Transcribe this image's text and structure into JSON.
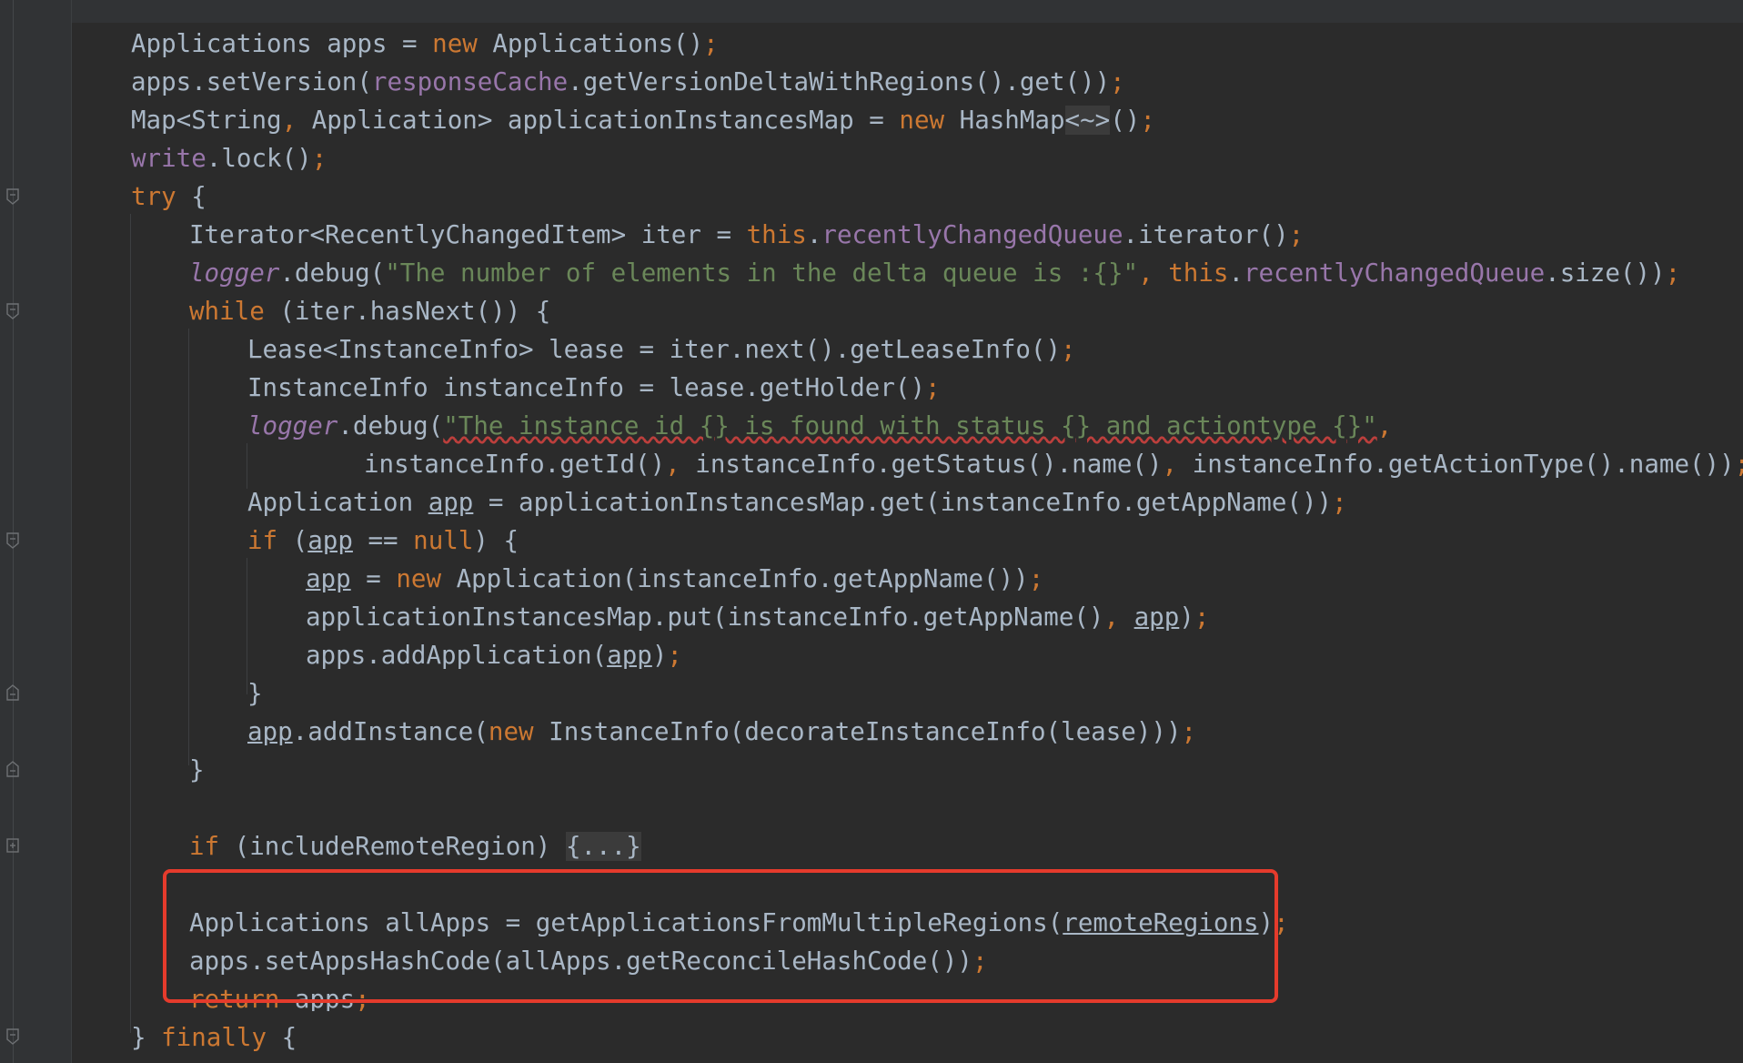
{
  "editor": {
    "lines": [
      {
        "id": "l1",
        "segments": [
          {
            "t": "Applications apps = "
          },
          {
            "t": "new",
            "c": "kw"
          },
          {
            "t": " Applications()"
          },
          {
            "t": ";",
            "c": "kw"
          }
        ]
      },
      {
        "id": "l2",
        "segments": [
          {
            "t": "apps.setVersion("
          },
          {
            "t": "responseCache",
            "c": "fld"
          },
          {
            "t": ".getVersionDeltaWithRegions().get())"
          },
          {
            "t": ";",
            "c": "kw"
          }
        ]
      },
      {
        "id": "l3",
        "segments": [
          {
            "t": "Map<String"
          },
          {
            "t": ",",
            "c": "kw"
          },
          {
            "t": " Application> applicationInstancesMap = "
          },
          {
            "t": "new",
            "c": "kw"
          },
          {
            "t": " HashMap"
          },
          {
            "t": "<~>",
            "c": "sel"
          },
          {
            "t": "()"
          },
          {
            "t": ";",
            "c": "kw"
          }
        ]
      },
      {
        "id": "l4",
        "segments": [
          {
            "t": "write",
            "c": "fld"
          },
          {
            "t": ".lock()"
          },
          {
            "t": ";",
            "c": "kw"
          }
        ]
      },
      {
        "id": "l5",
        "segments": [
          {
            "t": "try",
            "c": "kw"
          },
          {
            "t": " {"
          }
        ]
      },
      {
        "id": "l6",
        "segments": [
          {
            "t": "Iterator<RecentlyChangedItem> iter = "
          },
          {
            "t": "this",
            "c": "kw"
          },
          {
            "t": "."
          },
          {
            "t": "recentlyChangedQueue",
            "c": "fld"
          },
          {
            "t": ".iterator()"
          },
          {
            "t": ";",
            "c": "kw"
          }
        ]
      },
      {
        "id": "l7",
        "segments": [
          {
            "t": "logger",
            "c": "fld it"
          },
          {
            "t": ".debug("
          },
          {
            "t": "\"The number of elements in the delta queue is :{}\"",
            "c": "str"
          },
          {
            "t": ", ",
            "c": "kw"
          },
          {
            "t": "this",
            "c": "kw"
          },
          {
            "t": "."
          },
          {
            "t": "recentlyChangedQueue",
            "c": "fld"
          },
          {
            "t": ".size())"
          },
          {
            "t": ";",
            "c": "kw"
          }
        ]
      },
      {
        "id": "l8",
        "segments": [
          {
            "t": "while",
            "c": "kw"
          },
          {
            "t": " (iter.hasNext()) {"
          }
        ]
      },
      {
        "id": "l9",
        "segments": [
          {
            "t": "Lease<InstanceInfo> lease = iter.next().getLeaseInfo()"
          },
          {
            "t": ";",
            "c": "kw"
          }
        ]
      },
      {
        "id": "l10",
        "segments": [
          {
            "t": "InstanceInfo instanceInfo = lease.getHolder()"
          },
          {
            "t": ";",
            "c": "kw"
          }
        ]
      },
      {
        "id": "l11",
        "segments": [
          {
            "t": "logger",
            "c": "fld it"
          },
          {
            "t": ".debug("
          },
          {
            "t": "\"The instance id {} is found with status {} and actiontype {}\"",
            "c": "str wavy"
          },
          {
            "t": ",",
            "c": "kw"
          }
        ]
      },
      {
        "id": "l12",
        "segments": [
          {
            "t": "instanceInfo.getId()"
          },
          {
            "t": ",",
            "c": "kw"
          },
          {
            "t": " instanceInfo.getStatus().name()"
          },
          {
            "t": ",",
            "c": "kw"
          },
          {
            "t": " instanceInfo.getActionType().name())"
          },
          {
            "t": ";",
            "c": "kw"
          }
        ]
      },
      {
        "id": "l13",
        "segments": [
          {
            "t": "Application "
          },
          {
            "t": "app",
            "c": "und"
          },
          {
            "t": " = applicationInstancesMap.get(instanceInfo.getAppName())"
          },
          {
            "t": ";",
            "c": "kw"
          }
        ]
      },
      {
        "id": "l14",
        "segments": [
          {
            "t": "if",
            "c": "kw"
          },
          {
            "t": " ("
          },
          {
            "t": "app",
            "c": "und"
          },
          {
            "t": " == "
          },
          {
            "t": "null",
            "c": "kw"
          },
          {
            "t": ") {"
          }
        ]
      },
      {
        "id": "l15",
        "segments": [
          {
            "t": "app",
            "c": "und"
          },
          {
            "t": " = "
          },
          {
            "t": "new",
            "c": "kw"
          },
          {
            "t": " Application(instanceInfo.getAppName())"
          },
          {
            "t": ";",
            "c": "kw"
          }
        ]
      },
      {
        "id": "l16",
        "segments": [
          {
            "t": "applicationInstancesMap.put(instanceInfo.getAppName()"
          },
          {
            "t": ",",
            "c": "kw"
          },
          {
            "t": " "
          },
          {
            "t": "app",
            "c": "und"
          },
          {
            "t": ")"
          },
          {
            "t": ";",
            "c": "kw"
          }
        ]
      },
      {
        "id": "l17",
        "segments": [
          {
            "t": "apps.addApplication("
          },
          {
            "t": "app",
            "c": "und"
          },
          {
            "t": ")"
          },
          {
            "t": ";",
            "c": "kw"
          }
        ]
      },
      {
        "id": "l18",
        "segments": [
          {
            "t": "}"
          }
        ]
      },
      {
        "id": "l19",
        "segments": [
          {
            "t": "app",
            "c": "und"
          },
          {
            "t": ".addInstance("
          },
          {
            "t": "new",
            "c": "kw"
          },
          {
            "t": " InstanceInfo(decorateInstanceInfo(lease)))"
          },
          {
            "t": ";",
            "c": "kw"
          }
        ]
      },
      {
        "id": "l20",
        "segments": [
          {
            "t": "}"
          }
        ]
      },
      {
        "id": "l21",
        "segments": [
          {
            "t": "if",
            "c": "kw"
          },
          {
            "t": " (includeRemoteRegion) "
          },
          {
            "t": "{...}",
            "c": "folded"
          }
        ]
      },
      {
        "id": "l22",
        "segments": [
          {
            "t": "Applications allApps = getApplicationsFromMultipleRegions("
          },
          {
            "t": "remoteRegions",
            "c": "und"
          },
          {
            "t": ")"
          },
          {
            "t": ";",
            "c": "kw"
          }
        ]
      },
      {
        "id": "l23",
        "segments": [
          {
            "t": "apps.setAppsHashCode(allApps.getReconcileHashCode())"
          },
          {
            "t": ";",
            "c": "kw"
          }
        ]
      },
      {
        "id": "l24",
        "segments": [
          {
            "t": "return",
            "c": "kw"
          },
          {
            "t": " apps"
          },
          {
            "t": ";",
            "c": "kw"
          }
        ]
      },
      {
        "id": "l25",
        "segments": [
          {
            "t": "} "
          },
          {
            "t": "finally",
            "c": "kw"
          },
          {
            "t": " {"
          }
        ]
      }
    ]
  },
  "colors": {
    "background": "#2b2b2b",
    "keyword": "#cc7832",
    "field": "#9876aa",
    "string": "#6a8759",
    "text": "#a9b7c6",
    "highlight_box": "#e53b2c"
  }
}
